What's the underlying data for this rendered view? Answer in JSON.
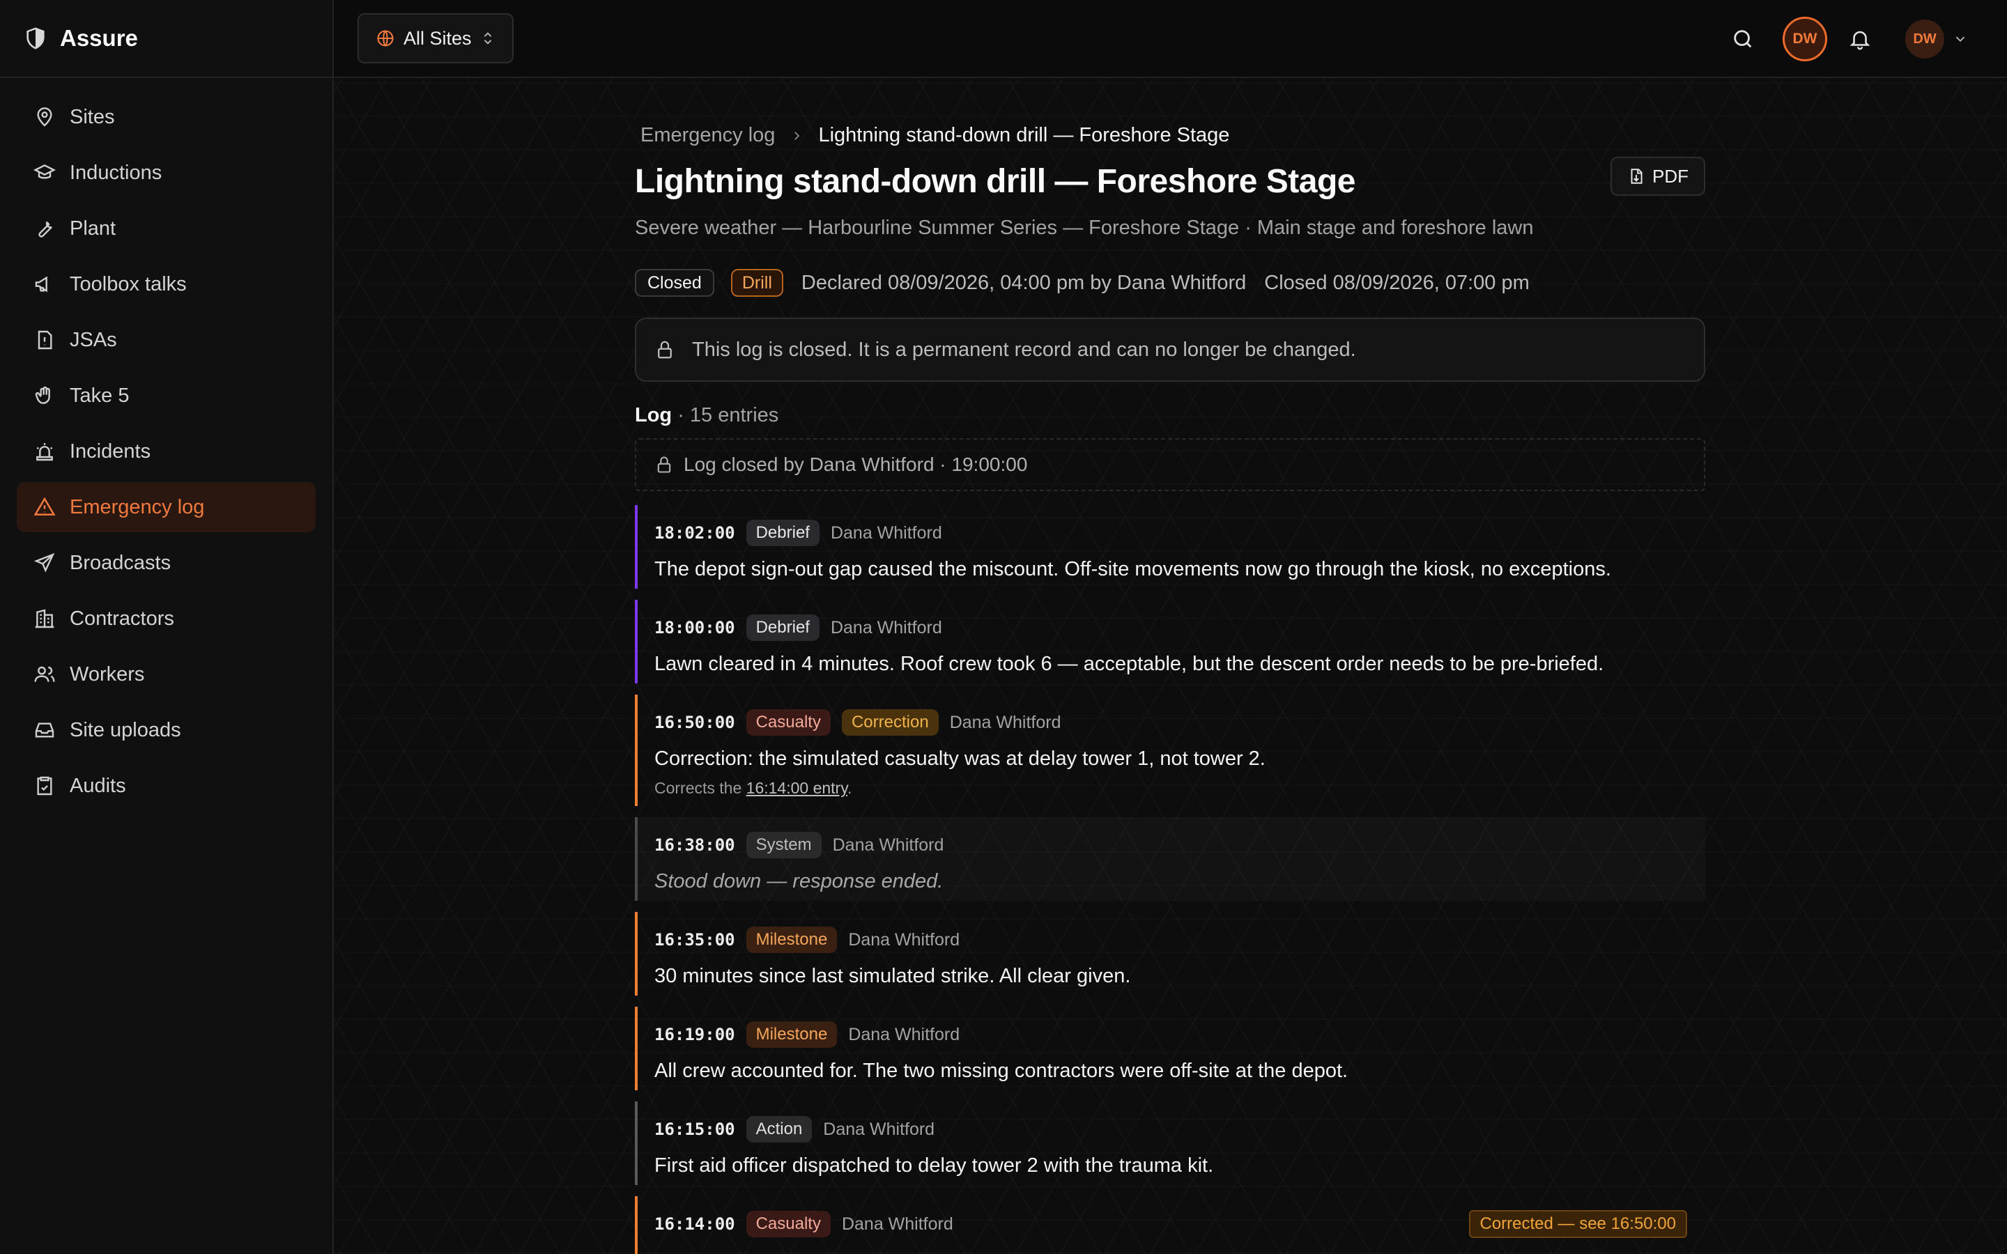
{
  "app": {
    "name": "Assure",
    "logo_icon": "shield-icon"
  },
  "sidebar": {
    "items": [
      {
        "label": "Sites",
        "icon": "map-pin-icon",
        "active": false
      },
      {
        "label": "Inductions",
        "icon": "graduation-cap-icon",
        "active": false
      },
      {
        "label": "Plant",
        "icon": "wrench-icon",
        "active": false
      },
      {
        "label": "Toolbox talks",
        "icon": "megaphone-icon",
        "active": false
      },
      {
        "label": "JSAs",
        "icon": "file-alert-icon",
        "active": false
      },
      {
        "label": "Take 5",
        "icon": "hand-icon",
        "active": false
      },
      {
        "label": "Incidents",
        "icon": "siren-icon",
        "active": false
      },
      {
        "label": "Emergency log",
        "icon": "alert-triangle-icon",
        "active": true
      },
      {
        "label": "Broadcasts",
        "icon": "send-icon",
        "active": false
      },
      {
        "label": "Contractors",
        "icon": "building-icon",
        "active": false
      },
      {
        "label": "Workers",
        "icon": "users-icon",
        "active": false
      },
      {
        "label": "Site uploads",
        "icon": "inbox-icon",
        "active": false
      },
      {
        "label": "Audits",
        "icon": "clipboard-check-icon",
        "active": false
      }
    ]
  },
  "topbar": {
    "site_switcher": "All Sites",
    "user_initials": "DW",
    "avatar_initials": "DW"
  },
  "breadcrumb": {
    "parent": "Emergency log",
    "current": "Lightning stand-down drill — Foreshore Stage"
  },
  "page": {
    "title": "Lightning stand-down drill — Foreshore Stage",
    "pdf_label": "PDF",
    "subtitle": "Severe weather — Harbourline Summer Series — Foreshore Stage · Main stage and foreshore lawn",
    "status": "Closed",
    "kind": "Drill",
    "declared": "Declared 08/09/2026, 04:00 pm by Dana Whitford",
    "closed": "Closed 08/09/2026, 07:00 pm",
    "closed_notice": "This log is closed. It is a permanent record and can no longer be changed."
  },
  "log": {
    "heading": "Log",
    "count": "· 15 entries",
    "closed_row": "Log closed by Dana Whitford · 19:00:00",
    "entries": [
      {
        "time": "18:02:00",
        "tag": "Debrief",
        "author": "Dana Whitford",
        "text": "The depot sign-out gap caused the miscount. Off-site movements now go through the kiosk, no exceptions."
      },
      {
        "time": "18:00:00",
        "tag": "Debrief",
        "author": "Dana Whitford",
        "text": "Lawn cleared in 4 minutes. Roof crew took 6 — acceptable, but the descent order needs to be pre-briefed."
      },
      {
        "time": "16:50:00",
        "tag": "Casualty",
        "tag2": "Correction",
        "author": "Dana Whitford",
        "text": "Correction: the simulated casualty was at delay tower 1, not tower 2.",
        "note_prefix": "Corrects the ",
        "note_link": "16:14:00 entry",
        "note_suffix": "."
      },
      {
        "time": "16:38:00",
        "tag": "System",
        "author": "Dana Whitford",
        "text": "Stood down — response ended."
      },
      {
        "time": "16:35:00",
        "tag": "Milestone",
        "author": "Dana Whitford",
        "text": "30 minutes since last simulated strike. All clear given."
      },
      {
        "time": "16:19:00",
        "tag": "Milestone",
        "author": "Dana Whitford",
        "text": "All crew accounted for. The two missing contractors were off-site at the depot."
      },
      {
        "time": "16:15:00",
        "tag": "Action",
        "author": "Dana Whitford",
        "text": "First aid officer dispatched to delay tower 2 with the trauma kit."
      },
      {
        "time": "16:14:00",
        "tag": "Casualty",
        "author": "Dana Whitford",
        "corrected": "Corrected — see 16:50:00"
      }
    ]
  },
  "colors": {
    "accent": "#f07a3e",
    "debrief": "#7c3aed",
    "casualty": "#f08030",
    "milestone": "#f08030",
    "system": "#4a4a4a",
    "action": "#5a5a5a"
  }
}
